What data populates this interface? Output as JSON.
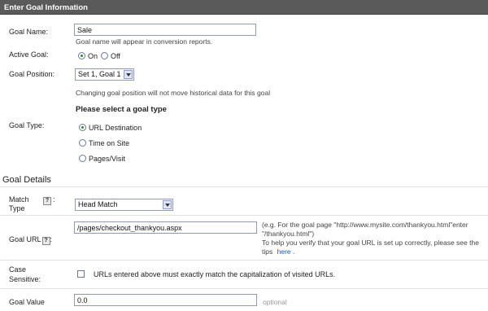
{
  "header": {
    "title": "Enter Goal Information"
  },
  "goal_name": {
    "label": "Goal Name:",
    "value": "Sale",
    "hint": "Goal name will appear in conversion reports."
  },
  "active_goal": {
    "label": "Active Goal:",
    "on_label": "On",
    "off_label": "Off",
    "selected": "On"
  },
  "goal_position": {
    "label": "Goal Position:",
    "selected": "Set 1, Goal 1",
    "note": "Changing goal position will not move historical data for this goal"
  },
  "goal_type": {
    "heading": "Please select a goal type",
    "label": "Goal Type:",
    "options": [
      "URL Destination",
      "Time on Site",
      "Pages/Visit"
    ],
    "selected": "URL Destination"
  },
  "goal_details": {
    "title": "Goal Details",
    "match_type": {
      "label_line1": "Match",
      "label_line2": "Type",
      "colon": ":",
      "help": "?",
      "selected": "Head Match"
    },
    "goal_url": {
      "label": "Goal URL",
      "colon": ":",
      "help": "?",
      "value": "/pages/checkout_thankyou.aspx",
      "example_line1": "(e.g. For the goal page \"http://www.mysite.com/thankyou.html\"enter",
      "example_line2": "\"/thankyou.html\")",
      "tip_line1": "To help you verify that your goal URL is set up correctly, please see the",
      "tip_prefix": "tips",
      "tip_link": "here",
      "tip_suffix": "."
    },
    "case_sensitive": {
      "label_line1": "Case",
      "label_line2": "Sensitive:",
      "text": "URLs entered above must exactly match the capitalization of visited URLs.",
      "checked": false
    },
    "goal_value": {
      "label": "Goal Value",
      "value": "0.0",
      "optional": "optional"
    }
  },
  "colors": {
    "header_bg": "#5a5a5a",
    "link": "#1a5ab4",
    "radio_selected": "#2a8a2a"
  }
}
